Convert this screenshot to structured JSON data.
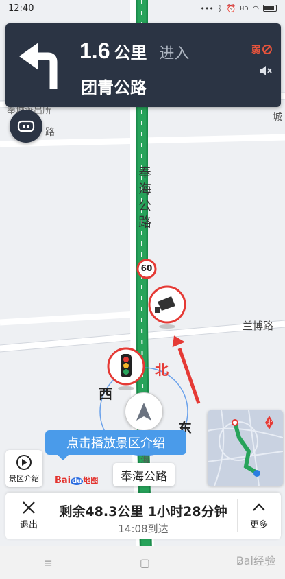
{
  "status_bar": {
    "time": "12:40",
    "icons": [
      "dots-icon",
      "bluetooth-icon",
      "alarm-icon",
      "hd-icon",
      "wifi-icon",
      "battery-icon"
    ]
  },
  "guidance": {
    "distance_value": "1.6",
    "distance_unit": "公里",
    "action": "进入",
    "road_name": "团青公路",
    "signal_label": "弱",
    "turn_direction": "left",
    "muted": true
  },
  "map": {
    "labels": {
      "police_station": "奉城派出所",
      "road_left": "路",
      "road_right_top": "城",
      "main_road": "奉海公路",
      "speed_limit": "60",
      "cross_road": "兰博路",
      "north": "北",
      "west": "西",
      "east": "东",
      "road_bottom": "海"
    },
    "route_color": "#27a35a",
    "arrow_color": "#e53a35"
  },
  "scenic": {
    "tooltip": "点击播放景区介绍",
    "button_label": "景区介绍"
  },
  "logo": {
    "prefix": "Bai",
    "icon": "du",
    "suffix": "地图"
  },
  "current_road": "奉海公路",
  "minimap": {
    "north": "北"
  },
  "bottom_bar": {
    "exit_label": "退出",
    "remaining": "剩余48.3公里 1小时28分钟",
    "eta": "14:08到达",
    "more_label": "更多"
  },
  "system_nav": {
    "menu": "≡",
    "home": "▢",
    "back": "‹"
  },
  "watermark": "Bai经验"
}
